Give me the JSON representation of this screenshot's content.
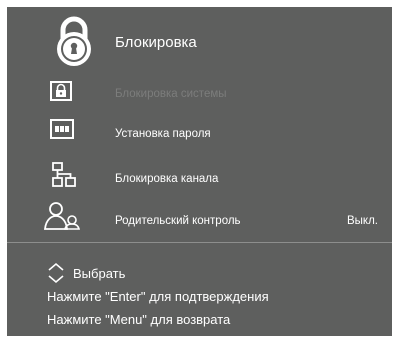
{
  "header": {
    "title": "Блокировка",
    "icon": "padlock-icon"
  },
  "menu": {
    "items": [
      {
        "label": "Блокировка системы",
        "icon": "lock-box-icon",
        "disabled": true,
        "value": ""
      },
      {
        "label": "Установка пароля",
        "icon": "password-field-icon",
        "disabled": false,
        "value": ""
      },
      {
        "label": "Блокировка канала",
        "icon": "channel-tree-icon",
        "disabled": false,
        "value": ""
      },
      {
        "label": "Родительский контроль",
        "icon": "parent-child-icon",
        "disabled": false,
        "value": "Выкл."
      }
    ]
  },
  "footer": {
    "select_label": "Выбрать",
    "enter_hint": "Нажмите \"Enter\" для подтверждения",
    "menu_hint": "Нажмите \"Menu\" для возврата"
  },
  "colors": {
    "background": "#5e5f5e",
    "text": "#ffffff",
    "disabled_text": "#7c7d7c"
  }
}
